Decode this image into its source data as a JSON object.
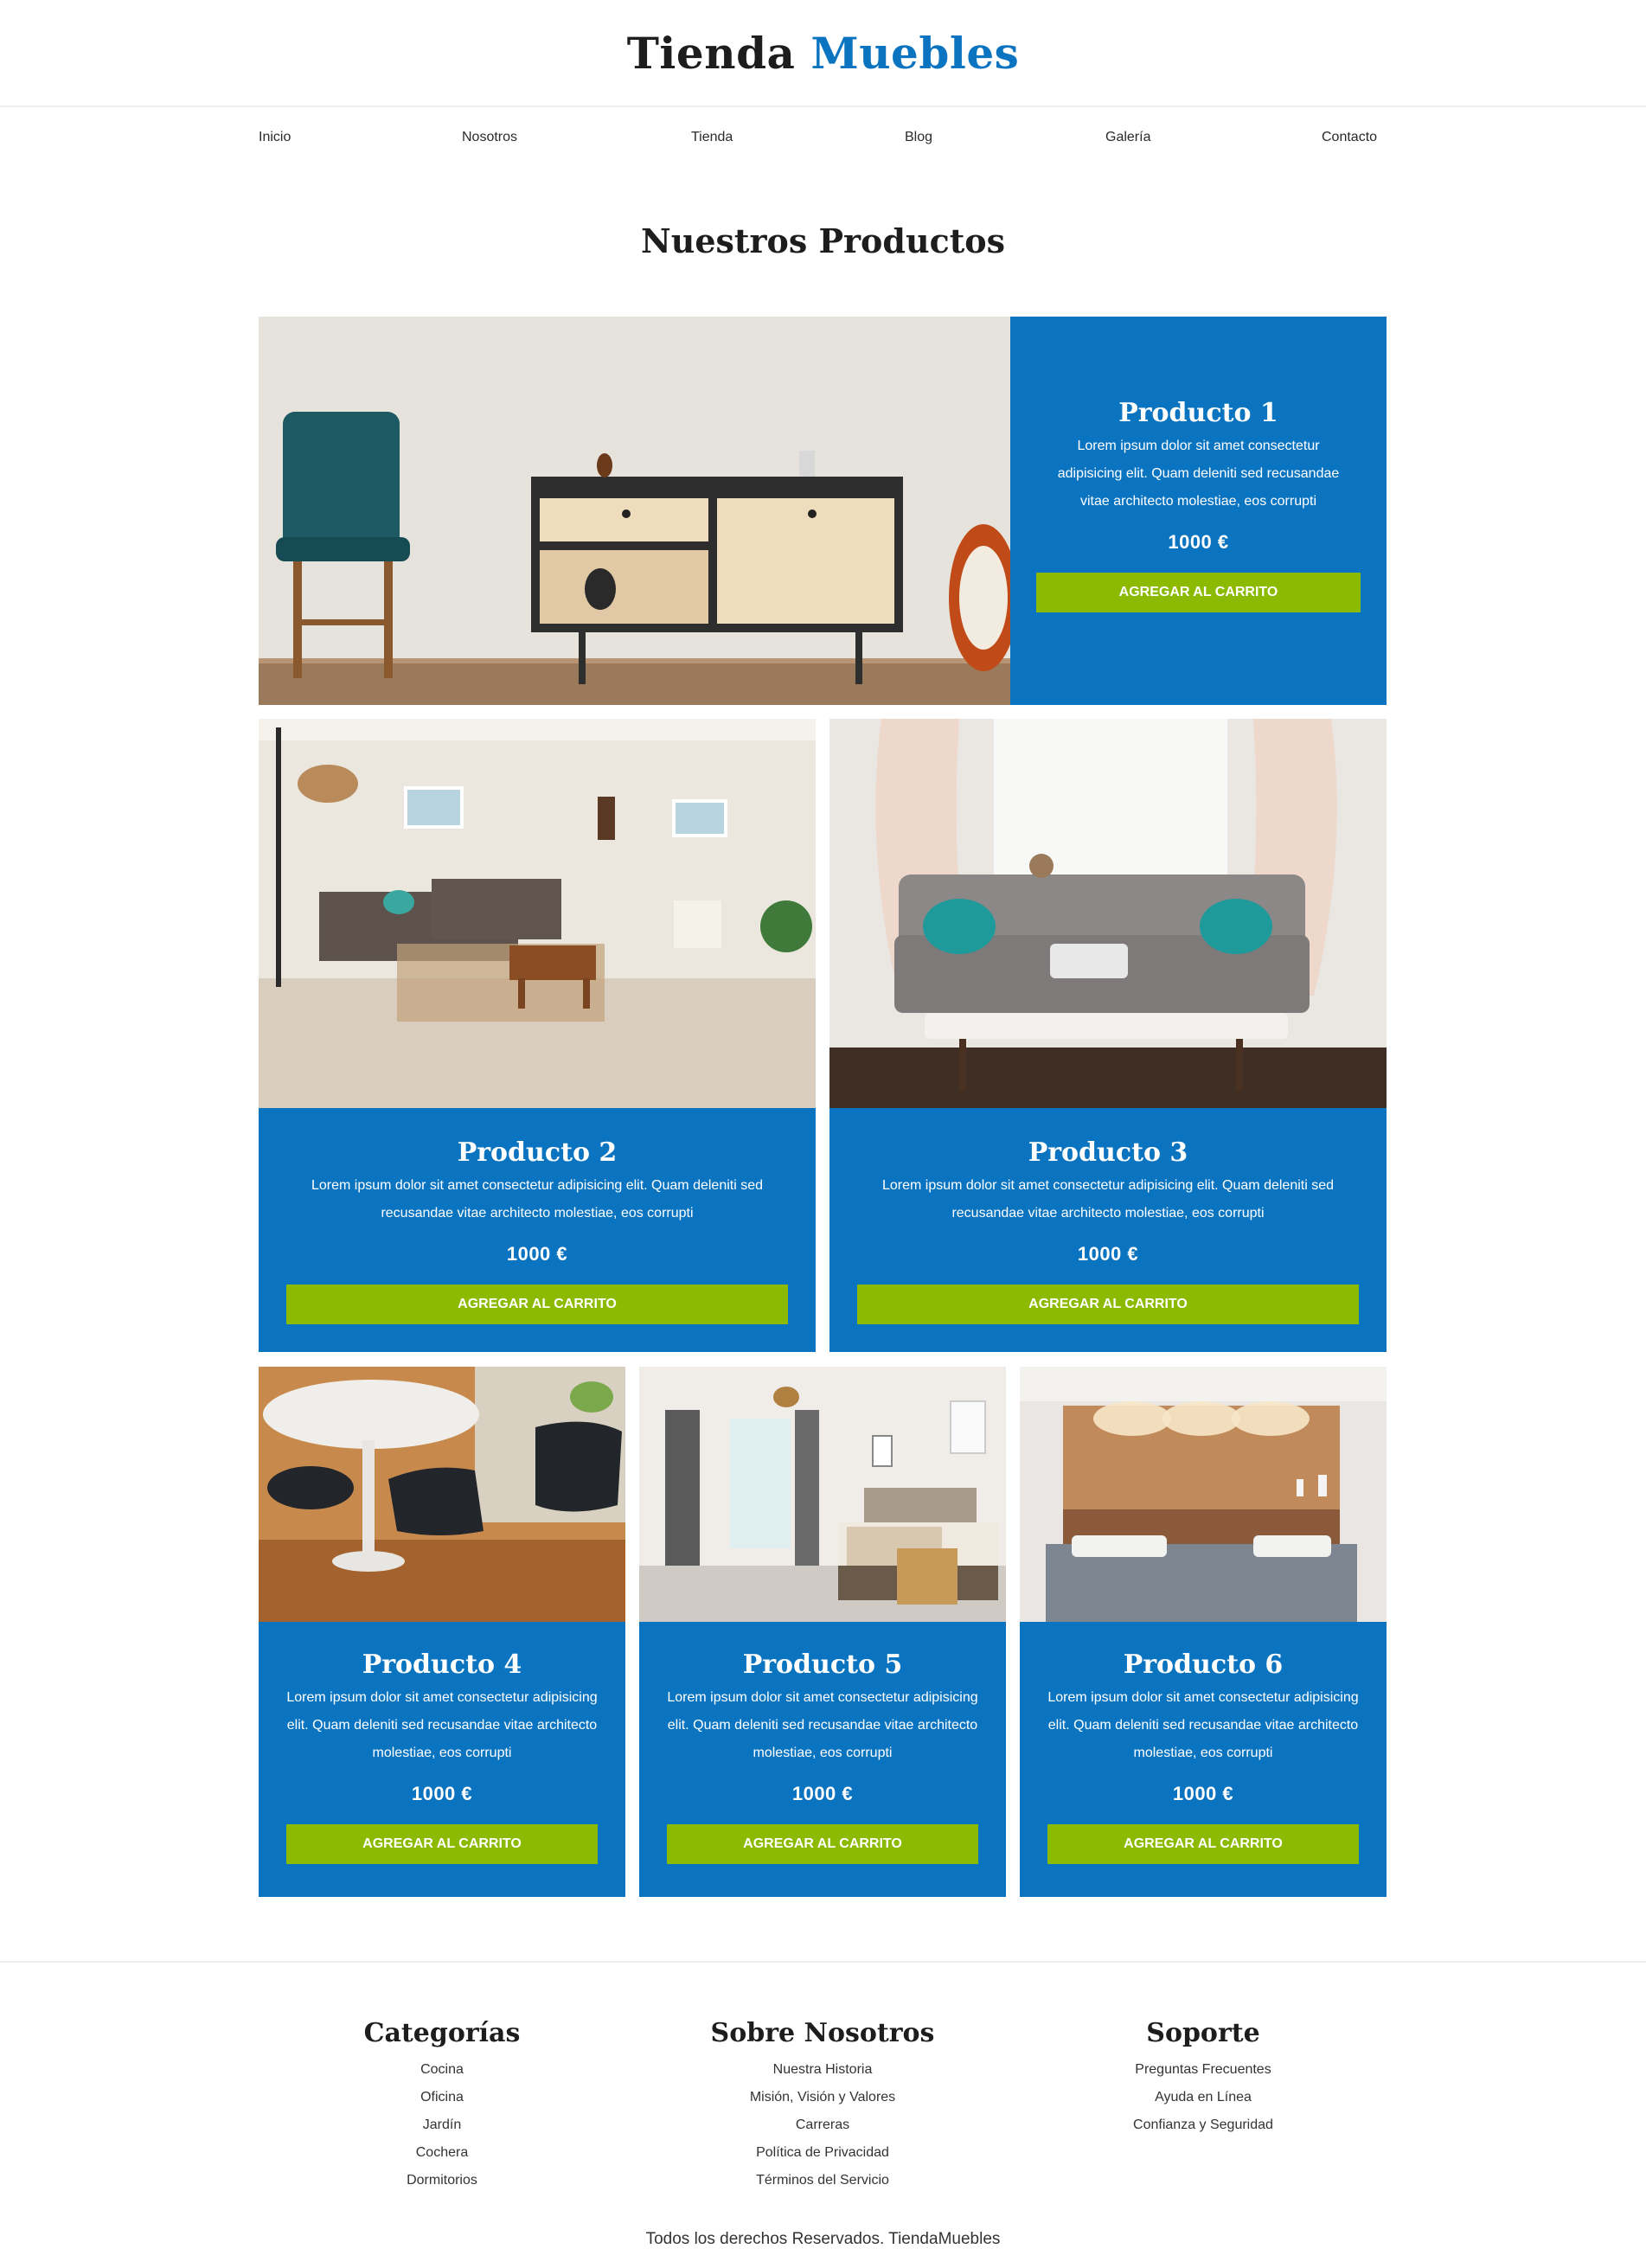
{
  "brand": {
    "name_part1": "Tienda",
    "name_part2": "Muebles"
  },
  "nav": [
    "Inicio",
    "Nosotros",
    "Tienda",
    "Blog",
    "Galería",
    "Contacto"
  ],
  "section_title": "Nuestros Productos",
  "products": [
    {
      "title": "Producto 1",
      "desc": "Lorem ipsum dolor sit amet consectetur adipisicing elit. Quam deleniti sed recusandae vitae architecto molestiae, eos corrupti",
      "price": "1000 €",
      "button": "Agregar al Carrito",
      "image": "sideboard-chair-photo"
    },
    {
      "title": "Producto 2",
      "desc": "Lorem ipsum dolor sit amet consectetur adipisicing elit. Quam deleniti sed recusandae vitae architecto molestiae, eos corrupti",
      "price": "1000 €",
      "button": "Agregar al Carrito",
      "image": "living-room-photo"
    },
    {
      "title": "Producto 3",
      "desc": "Lorem ipsum dolor sit amet consectetur adipisicing elit. Quam deleniti sed recusandae vitae architecto molestiae, eos corrupti",
      "price": "1000 €",
      "button": "Agregar al Carrito",
      "image": "sofa-photo"
    },
    {
      "title": "Producto 4",
      "desc": "Lorem ipsum dolor sit amet consectetur adipisicing elit. Quam deleniti sed recusandae vitae architecto molestiae, eos corrupti",
      "price": "1000 €",
      "button": "Agregar al Carrito",
      "image": "dining-table-photo"
    },
    {
      "title": "Producto 5",
      "desc": "Lorem ipsum dolor sit amet consectetur adipisicing elit. Quam deleniti sed recusandae vitae architecto molestiae, eos corrupti",
      "price": "1000 €",
      "button": "Agregar al Carrito",
      "image": "bedroom-photo"
    },
    {
      "title": "Producto 6",
      "desc": "Lorem ipsum dolor sit amet consectetur adipisicing elit. Quam deleniti sed recusandae vitae architecto molestiae, eos corrupti",
      "price": "1000 €",
      "button": "Agregar al Carrito",
      "image": "wood-bedroom-photo"
    }
  ],
  "footer": {
    "columns": [
      {
        "title": "Categorías",
        "links": [
          "Cocina",
          "Oficina",
          "Jardín",
          "Cochera",
          "Dormitorios"
        ]
      },
      {
        "title": "Sobre Nosotros",
        "links": [
          "Nuestra Historia",
          "Misión, Visión y Valores",
          "Carreras",
          "Política de Privacidad",
          "Términos del Servicio"
        ]
      },
      {
        "title": "Soporte",
        "links": [
          "Preguntas Frecuentes",
          "Ayuda en Línea",
          "Confianza y Seguridad"
        ]
      }
    ],
    "copyright": "Todos los derechos Reservados. TiendaMuebles"
  },
  "colors": {
    "brand_blue": "#0a74c1",
    "button_green": "#8bba00",
    "text_dark": "#1d1d1d"
  }
}
